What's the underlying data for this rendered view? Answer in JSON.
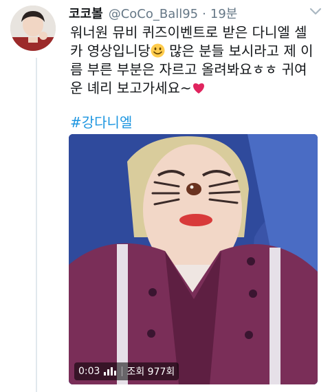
{
  "tweet": {
    "display_name": "코코볼",
    "handle": "@CoCo_Ball95",
    "separator": "·",
    "time": "19분",
    "text_part1": "워너원 뮤비 퀴즈이벤트로 받은 다니엘 셀카 영상입니당",
    "text_part2": " 많은 분들 보시라고 제 이름 부른 부분은 자르고 올려봐요ㅎㅎ 귀여운 녜리 보고가세요~",
    "hashtag": "#강다니엘"
  },
  "video": {
    "duration": "0:03",
    "views": "조회 977회"
  },
  "icons": {
    "menu": "chevron-down-icon",
    "emoji1": "smiling-face-icon",
    "emoji2": "heart-icon",
    "audio": "volume-bars-icon"
  },
  "colors": {
    "link": "#1b95e0",
    "secondary_text": "#657786",
    "heart": "#e0245e"
  }
}
